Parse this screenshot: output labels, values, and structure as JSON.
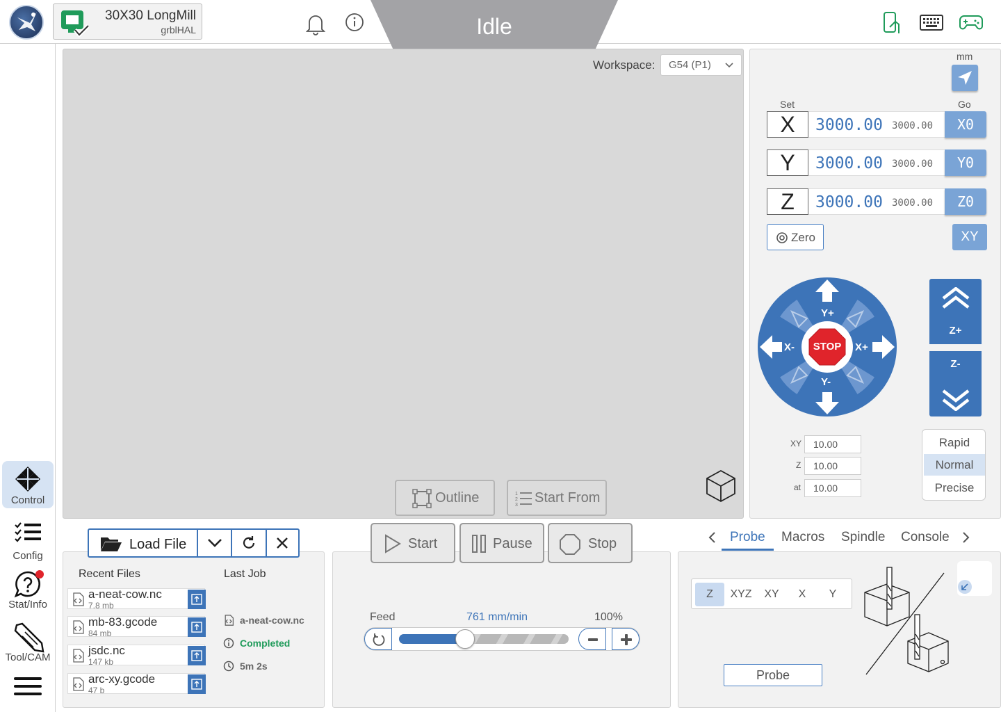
{
  "machine": {
    "name": "30X30 LongMill",
    "firmware": "grblHAL"
  },
  "status": "Idle",
  "rail": {
    "items": [
      {
        "label": "Control",
        "icon": "control-icon"
      },
      {
        "label": "Config",
        "icon": "config-list-icon"
      },
      {
        "label": "Stat/Info",
        "icon": "help-icon"
      },
      {
        "label": "Tool/CAM",
        "icon": "endmill-icon"
      }
    ]
  },
  "visualizer": {
    "workspace_label": "Workspace:",
    "workspace_value": "G54 (P1)",
    "outline_label": "Outline",
    "start_from_label": "Start From"
  },
  "dro": {
    "unit": "mm",
    "set_label": "Set",
    "go_label": "Go",
    "axes": [
      {
        "axis": "X",
        "work": "3000.00",
        "machine": "3000.00",
        "go": "X0"
      },
      {
        "axis": "Y",
        "work": "3000.00",
        "machine": "3000.00",
        "go": "Y0"
      },
      {
        "axis": "Z",
        "work": "3000.00",
        "machine": "3000.00",
        "go": "Z0"
      }
    ],
    "zero_label": "Zero",
    "xy_label": "XY"
  },
  "jog": {
    "y_plus": "Y+",
    "y_minus": "Y-",
    "x_plus": "X+",
    "x_minus": "X-",
    "stop": "STOP",
    "z_plus": "Z+",
    "z_minus": "Z-",
    "xy_label": "XY",
    "xy_value": "10.00",
    "z_label": "Z",
    "z_value": "10.00",
    "at_label": "at",
    "at_value": "10.00",
    "speeds": [
      "Rapid",
      "Normal",
      "Precise"
    ],
    "selected_speed": "Normal"
  },
  "files": {
    "load_label": "Load File",
    "recent_title": "Recent Files",
    "recent": [
      {
        "name": "a-neat-cow.nc",
        "size": "7.8 mb"
      },
      {
        "name": "mb-83.gcode",
        "size": "84 mb"
      },
      {
        "name": "jsdc.nc",
        "size": "147 kb"
      },
      {
        "name": "arc-xy.gcode",
        "size": "47 b"
      }
    ],
    "last_job_title": "Last Job",
    "last_job": {
      "file": "a-neat-cow.nc",
      "status": "Completed",
      "duration": "5m 2s"
    }
  },
  "run": {
    "start_label": "Start",
    "pause_label": "Pause",
    "stop_label": "Stop",
    "feed_label": "Feed",
    "feed_rate": "761 mm/min",
    "feed_percent_label": "100%",
    "feed_fraction": 0.39
  },
  "tools": {
    "tabs": [
      "Probe",
      "Macros",
      "Spindle",
      "Console"
    ],
    "active_tab": "Probe",
    "probe_axes": [
      "Z",
      "XYZ",
      "XY",
      "X",
      "Y"
    ],
    "selected_axis": "Z",
    "probe_button": "Probe"
  },
  "colors": {
    "accent": "#3d74b8",
    "status_bg": "#a3a3a6",
    "green": "#1f9b5a",
    "stop_red": "#e0242b"
  }
}
